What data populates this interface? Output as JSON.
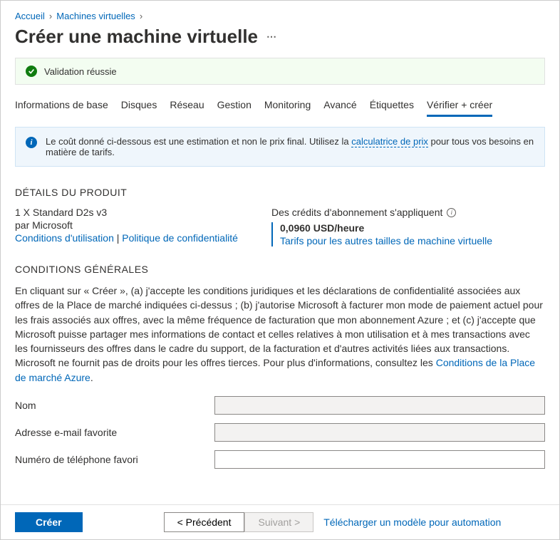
{
  "breadcrumb": {
    "home": "Accueil",
    "vms": "Machines virtuelles"
  },
  "title": "Créer une machine virtuelle",
  "validation": {
    "text": "Validation réussie"
  },
  "tabs": {
    "basics": "Informations de base",
    "disks": "Disques",
    "network": "Réseau",
    "management": "Gestion",
    "monitoring": "Monitoring",
    "advanced": "Avancé",
    "tags": "Étiquettes",
    "review": "Vérifier + créer"
  },
  "infobox": {
    "text_before": "Le coût donné ci-dessous est une estimation et non le prix final. Utilisez la ",
    "link": "calculatrice de prix",
    "text_after": " pour tous vos besoins en matière de tarifs."
  },
  "product": {
    "section_title": "DÉTAILS DU PRODUIT",
    "sku": "1 X Standard D2s v3",
    "by": "par Microsoft",
    "terms_link": "Conditions d'utilisation",
    "privacy_link": "Politique de confidentialité",
    "credits": "Des crédits d'abonnement s'appliquent",
    "price": "0,0960 USD/heure",
    "pricing_link": "Tarifs pour les autres tailles de machine virtuelle"
  },
  "terms": {
    "section_title": "CONDITIONS GÉNÉRALES",
    "body_before": "En cliquant sur « Créer », (a) j'accepte les conditions juridiques et les déclarations de confidentialité associées aux offres de la Place de marché indiquées ci-dessus ; (b) j'autorise Microsoft à facturer mon mode de paiement actuel pour les frais associés aux offres, avec la même fréquence de facturation que mon abonnement Azure ; et (c) j'accepte que Microsoft puisse partager mes informations de contact et celles relatives à mon utilisation et à mes transactions avec les fournisseurs des offres dans le cadre du support, de la facturation et d'autres activités liées aux transactions. Microsoft ne fournit pas de droits pour les offres tierces. Pour plus d'informations, consultez les ",
    "link": "Conditions de la Place de marché Azure",
    "body_after": "."
  },
  "form": {
    "name_label": "Nom",
    "email_label": "Adresse e-mail favorite",
    "phone_label": "Numéro de téléphone favori"
  },
  "footer": {
    "create": "Créer",
    "prev": "<  Précédent",
    "next": "Suivant  >",
    "download": "Télécharger un modèle pour automation"
  }
}
